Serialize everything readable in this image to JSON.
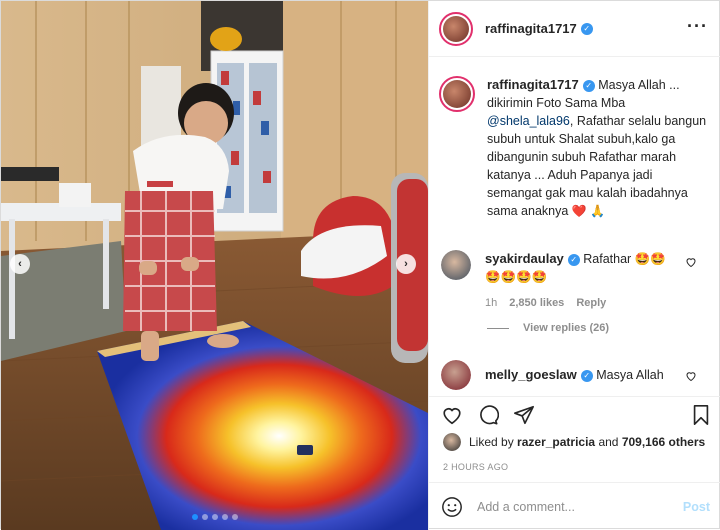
{
  "account": {
    "username": "raffinagita1717",
    "verified_icon": "verified-badge-icon"
  },
  "caption": {
    "username": "raffinagita1717",
    "text_before_mention": "Masya Allah ... dikirimin Foto Sama Mba",
    "mention": "@shela_lala96",
    "text_after_mention": ", Rafathar selalu bangun subuh untuk Shalat subuh,kalo ga dibangunin subuh Rafathar marah katanya ... Aduh Papanya jadi semangat gak mau kalah ibadahnya sama anaknya",
    "emoji": "❤️ 🙏"
  },
  "comments": [
    {
      "username": "syakirdaulay",
      "text": "Rafathar 🤩🤩",
      "text_line2": "🤩🤩🤩🤩",
      "time": "1h",
      "likes": "2,850 likes",
      "reply_label": "Reply",
      "view_replies": "View replies (26)"
    },
    {
      "username": "melly_goeslaw",
      "text": "Masya Allah"
    }
  ],
  "likes": {
    "prefix": "Liked by",
    "user": "razer_patricia",
    "middle": "and",
    "count": "709,166 others"
  },
  "timestamp": "2 HOURS AGO",
  "add_comment": {
    "placeholder": "Add a comment...",
    "post_label": "Post"
  },
  "carousel": {
    "slide_count": 5,
    "active_index": 0
  },
  "colors": {
    "link": "#00376b",
    "verified": "#3897f0",
    "muted": "#8e8e8e",
    "post_disabled": "#b2dffc"
  }
}
